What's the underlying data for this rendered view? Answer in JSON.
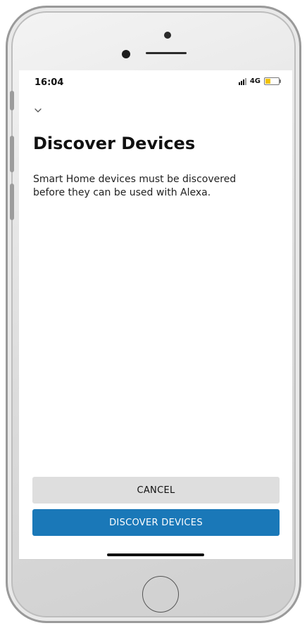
{
  "status_bar": {
    "time": "16:04",
    "network": "4G",
    "battery_level": 0.35,
    "battery_color": "#f2c200"
  },
  "header": {
    "collapse_icon": "chevron-down-icon"
  },
  "main": {
    "title": "Discover Devices",
    "description": "Smart Home devices must be discovered before they can be used with Alexa."
  },
  "actions": {
    "cancel_label": "CANCEL",
    "discover_label": "DISCOVER DEVICES",
    "primary_color": "#1a78b8",
    "secondary_color": "#dedede"
  }
}
